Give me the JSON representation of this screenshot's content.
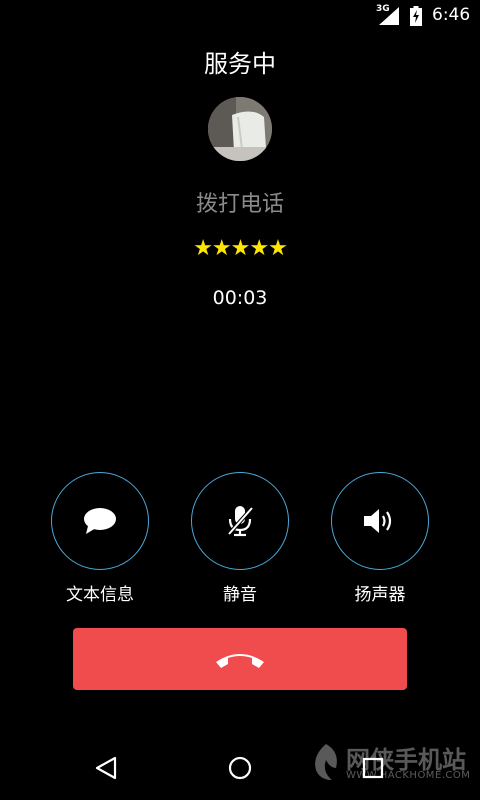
{
  "status_bar": {
    "network": "3G",
    "time": "6:46"
  },
  "call": {
    "status_title": "服务中",
    "caller_name": "拨打电话",
    "rating": {
      "text": "★★★★★",
      "stars": 5
    },
    "timer": "00:03"
  },
  "actions": {
    "message_label": "文本信息",
    "mute_label": "静音",
    "speaker_label": "扬声器"
  },
  "colors": {
    "accent_ring": "#4aa8d8",
    "end_call": "#f04b4d",
    "stars": "#ffe600"
  },
  "watermark": {
    "title": "网侠手机站",
    "subtitle": "WWW.HACKHOME.COM"
  }
}
